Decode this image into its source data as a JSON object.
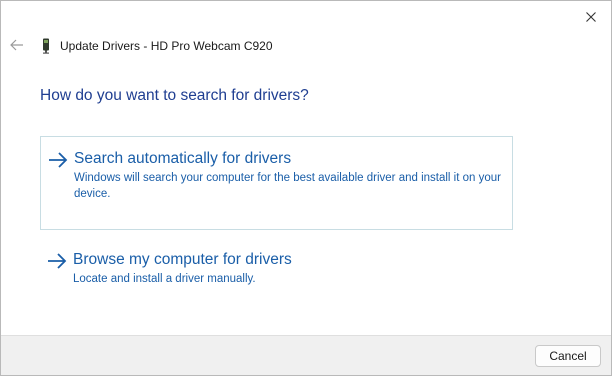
{
  "window": {
    "title": "Update Drivers - HD Pro Webcam C920"
  },
  "main": {
    "heading": "How do you want to search for drivers?",
    "options": [
      {
        "title": "Search automatically for drivers",
        "description": "Windows will search your computer for the best available driver and install it on your device."
      },
      {
        "title": "Browse my computer for drivers",
        "description": "Locate and install a driver manually."
      }
    ]
  },
  "footer": {
    "cancel_label": "Cancel"
  },
  "icons": {
    "close": "close-icon",
    "back": "back-arrow-icon",
    "device": "webcam-icon",
    "option_arrow": "right-arrow-icon"
  },
  "colors": {
    "heading": "#1f3e91",
    "link": "#1a5ea8",
    "selected_border": "#c8dde3",
    "footer_bg": "#f0f0f0"
  }
}
